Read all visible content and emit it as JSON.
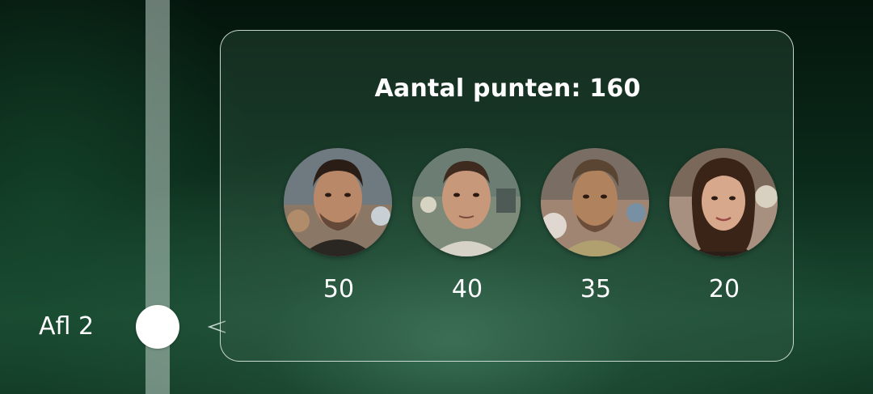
{
  "timeline": {
    "episode_label": "Afl 2"
  },
  "summary": {
    "title": "Aantal punten: 160"
  },
  "players": [
    {
      "score": "50",
      "avatar_icon": "man-portrait-avatar"
    },
    {
      "score": "40",
      "avatar_icon": "man-portrait-avatar"
    },
    {
      "score": "35",
      "avatar_icon": "man-portrait-avatar"
    },
    {
      "score": "20",
      "avatar_icon": "woman-portrait-avatar"
    }
  ],
  "colors": {
    "background": "#0b2a1a",
    "text": "#ffffff",
    "timeline_track": "#bccdc6",
    "bubble_border": "#e6f0eb"
  }
}
